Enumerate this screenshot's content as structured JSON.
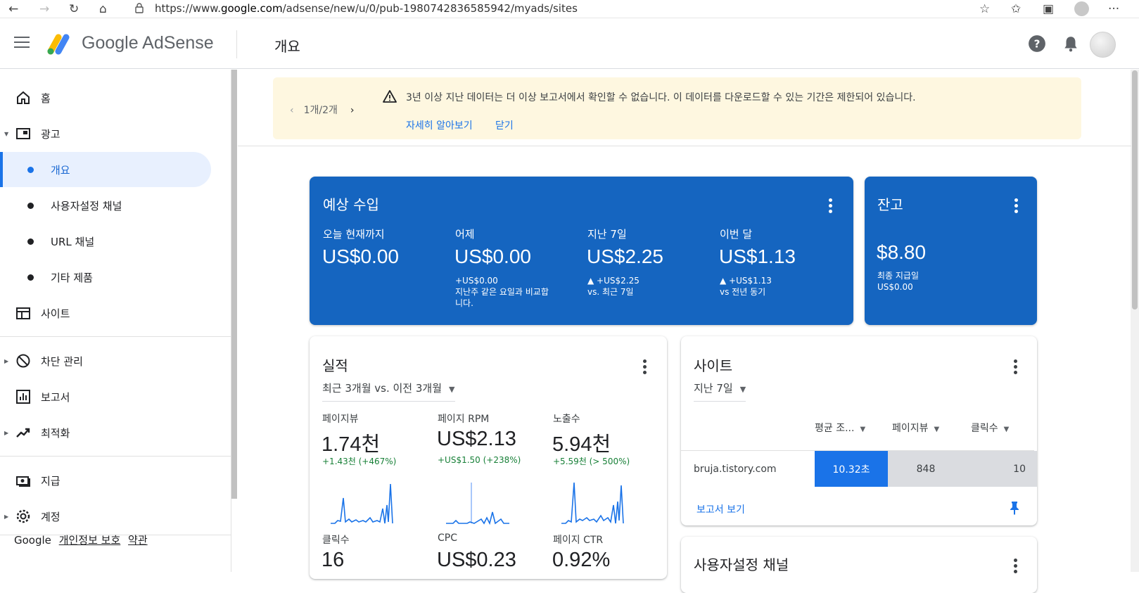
{
  "browser": {
    "url_prefix": "https://www.",
    "url_domain": "google.com",
    "url_path": "/adsense/new/u/0/pub-1980742836585942/myads/sites"
  },
  "header": {
    "brand": "Google AdSense",
    "page_title": "개요"
  },
  "sidebar": {
    "items": [
      {
        "label": "홈"
      },
      {
        "label": "광고"
      },
      {
        "label": "개요"
      },
      {
        "label": "사용자설정 채널"
      },
      {
        "label": "URL 채널"
      },
      {
        "label": "기타 제품"
      },
      {
        "label": "사이트"
      },
      {
        "label": "차단 관리"
      },
      {
        "label": "보고서"
      },
      {
        "label": "최적화"
      },
      {
        "label": "지급"
      },
      {
        "label": "계정"
      }
    ],
    "footer": {
      "google": "Google",
      "privacy": "개인정보 보호",
      "terms": "약관"
    }
  },
  "banner": {
    "pager": "1개/2개",
    "message": "3년 이상 지난 데이터는 더 이상 보고서에서 확인할 수 없습니다. 이 데이터를 다운로드할 수 있는 기간은 제한되어 있습니다.",
    "learn_more": "자세히 알아보기",
    "dismiss": "닫기"
  },
  "earnings": {
    "title": "예상 수입",
    "metrics": [
      {
        "label": "오늘 현재까지",
        "value": "US$0.00",
        "sub1": "",
        "sub2": "",
        "sub3": ""
      },
      {
        "label": "어제",
        "value": "US$0.00",
        "sub1": "+US$0.00",
        "sub2": "지난주 같은 요일과 비교합",
        "sub3": "니다."
      },
      {
        "label": "지난 7일",
        "value": "US$2.25",
        "sub1": "▲ +US$2.25",
        "sub2": "vs. 최근 7일",
        "sub3": ""
      },
      {
        "label": "이번 달",
        "value": "US$1.13",
        "sub1": "▲ +US$1.13",
        "sub2": "vs 전년 동기",
        "sub3": ""
      }
    ]
  },
  "balance": {
    "title": "잔고",
    "value": "$8.80",
    "last_payment_label": "최종 지급일",
    "last_payment_value": "US$0.00"
  },
  "performance": {
    "title": "실적",
    "range": "최근 3개월 vs. 이전 3개월",
    "metrics": [
      {
        "label": "페이지뷰",
        "value": "1.74천",
        "change": "+1.43천 (+467%)"
      },
      {
        "label": "페이지 RPM",
        "value": "US$2.13",
        "change": "+US$1.50 (+238%)"
      },
      {
        "label": "노출수",
        "value": "5.94천",
        "change": "+5.59천 (> 500%)"
      },
      {
        "label": "클릭수",
        "value": "16",
        "change": ""
      },
      {
        "label": "CPC",
        "value": "US$0.23",
        "change": ""
      },
      {
        "label": "페이지 CTR",
        "value": "0.92%",
        "change": ""
      }
    ]
  },
  "sites": {
    "title": "사이트",
    "range": "지난 7일",
    "columns": [
      "평균 조...",
      "페이지뷰",
      "클릭수"
    ],
    "rows": [
      {
        "site": "bruja.tistory.com",
        "avg": "10.32초",
        "pageviews": "848",
        "clicks": "10"
      }
    ],
    "report_link": "보고서 보기"
  },
  "channels": {
    "title": "사용자설정 채널"
  },
  "colors": {
    "accent": "#1a73e8",
    "card_blue": "#1565c0",
    "banner_bg": "#fef7e0",
    "positive": "#188038"
  }
}
